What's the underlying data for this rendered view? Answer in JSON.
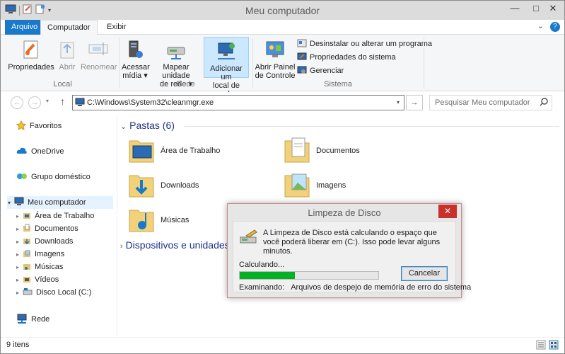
{
  "window": {
    "title": "Meu computador",
    "minimize_glyph": "—",
    "maximize_glyph": "□",
    "close_glyph": "✕"
  },
  "ribbon_tabs": {
    "file": "Arquivo",
    "computer": "Computador",
    "view": "Exibir"
  },
  "help_glyphs": {
    "expand": "⌄",
    "help": "?"
  },
  "ribbon": {
    "local": {
      "label": "Local",
      "properties": "Propriedades",
      "open": "Abrir",
      "rename": "Renomear"
    },
    "network": {
      "label": "Rede",
      "access_media_1": "Acessar",
      "access_media_2": "mídia",
      "map_drive_1": "Mapear unidade",
      "map_drive_2": "de rede",
      "add_location_1": "Adicionar um",
      "add_location_2": "local de rede"
    },
    "system": {
      "label": "Sistema",
      "control_panel_1": "Abrir Painel",
      "control_panel_2": "de Controle",
      "uninstall": "Desinstalar ou alterar um programa",
      "system_properties": "Propriedades do sistema",
      "manage": "Gerenciar"
    },
    "dropdown_glyph": "▾"
  },
  "address": {
    "path": "C:\\Windows\\System32\\cleanmgr.exe",
    "search_placeholder": "Pesquisar Meu computador",
    "back": "←",
    "forward": "→",
    "recent": "▾",
    "up": "↑",
    "dropdown": "▾",
    "go": "→"
  },
  "nav": {
    "favorites": "Favoritos",
    "onedrive": "OneDrive",
    "homegroup": "Grupo doméstico",
    "computer": "Meu computador",
    "children": [
      "Área de Trabalho",
      "Documentos",
      "Downloads",
      "Imagens",
      "Músicas",
      "Vídeos",
      "Disco Local (C:)"
    ],
    "network": "Rede",
    "expand_glyph": "▸",
    "collapse_glyph": "▾"
  },
  "content": {
    "folders_header": "Pastas (6)",
    "folders": [
      "Área de Trabalho",
      "Documentos",
      "Downloads",
      "Imagens",
      "Músicas"
    ],
    "devices_header": "Dispositivos e unidades",
    "header_expanded_glyph": "⌄",
    "header_collapsed_glyph": "›"
  },
  "status": {
    "count": "9 itens"
  },
  "dialog": {
    "title": "Limpeza de Disco",
    "close_glyph": "✕",
    "message": "A Limpeza de Disco está calculando o espaço que você poderá liberar em  (C:). Isso pode levar alguns minutos.",
    "calculating": "Calculando...",
    "progress": 0.4,
    "cancel": "Cancelar",
    "examining_label": "Examinando:",
    "examining_value": "Arquivos de despejo de memória de erro do sistema"
  },
  "colors": {
    "accent": "#1979ca",
    "progress": "#06b025",
    "selection": "#cce8ff",
    "close_red": "#c7302b"
  }
}
